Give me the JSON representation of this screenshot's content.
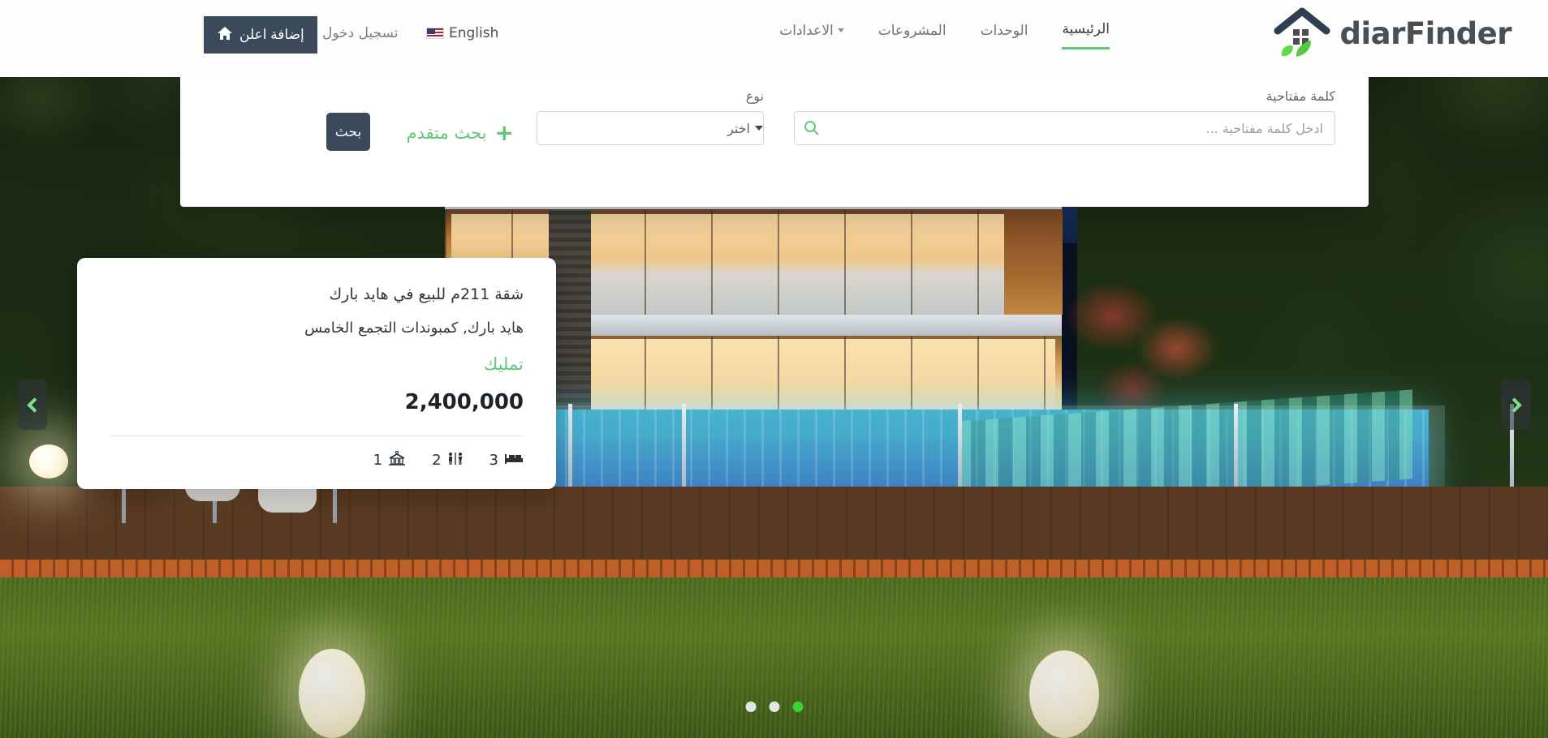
{
  "site": {
    "logo_text": "diarFinder",
    "accent_green": "#5ec97a",
    "dark_navy": "#3b4a5a"
  },
  "header": {
    "nav": [
      {
        "label": "الرئيسية",
        "active": true,
        "has_caret": false
      },
      {
        "label": "الوحدات",
        "active": false,
        "has_caret": false
      },
      {
        "label": "المشروعات",
        "active": false,
        "has_caret": false
      },
      {
        "label": "الاعدادات",
        "active": false,
        "has_caret": true
      }
    ],
    "add_listing_label": "إضافة اعلن",
    "login_label": "تسجيل دخول",
    "language_label": "English"
  },
  "search": {
    "keyword_label": "كلمة مفتاحية",
    "keyword_placeholder": "ادخل كلمة مفتاحية ...",
    "keyword_value": "",
    "type_label": "نوع",
    "type_value": "اختر",
    "type_options": [
      "اختر"
    ],
    "advanced_label": "بحث متقدم",
    "advanced_plus": "+",
    "search_button_label": "بحث"
  },
  "property_card": {
    "title": "شقة 211م للبيع في هايد بارك",
    "location": "هايد بارك, كمبوندات التجمع الخامس",
    "tag": "تمليك",
    "price": "2,400,000",
    "specs": [
      {
        "icon": "bed-icon",
        "value": "3"
      },
      {
        "icon": "bathroom-icon",
        "value": "2"
      },
      {
        "icon": "garage-icon",
        "value": "1"
      }
    ]
  },
  "carousel": {
    "prev_label": "‹",
    "next_label": "›",
    "dots": [
      {
        "active": true
      },
      {
        "active": false
      },
      {
        "active": false
      }
    ]
  }
}
